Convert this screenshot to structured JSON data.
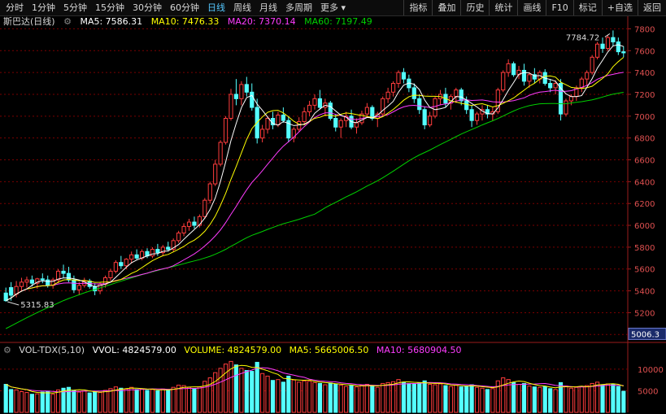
{
  "toolbar": {
    "periods": [
      "分时",
      "1分钟",
      "5分钟",
      "15分钟",
      "30分钟",
      "60分钟",
      "日线",
      "周线",
      "月线",
      "多周期",
      "更多"
    ],
    "active_period": "日线",
    "right_buttons": [
      "指标",
      "叠加",
      "历史",
      "统计",
      "画线",
      "F10",
      "标记",
      "+自选",
      "返回"
    ]
  },
  "price_panel": {
    "stock_name": "斯巴达(日线)",
    "ma5": "MA5: 7586.31",
    "ma10": "MA10: 7476.33",
    "ma20": "MA20: 7370.14",
    "ma60": "MA60: 7197.49",
    "high_marker": "7784.72",
    "low_marker": "5315.83",
    "current_price_tag": "5006.3",
    "y_ticks": [
      "7800",
      "7600",
      "7400",
      "7200",
      "7000",
      "6800",
      "6600",
      "6400",
      "6200",
      "6000",
      "5800",
      "5600",
      "5400",
      "5200",
      "5000"
    ]
  },
  "volume_panel": {
    "indicator": "VOL-TDX(5,10)",
    "vvol": "VVOL: 4824579.00",
    "volume": "VOLUME: 4824579.00",
    "ma5": "MA5: 5665006.50",
    "ma10": "MA10: 5680904.50",
    "y_ticks": [
      "10000",
      "5000"
    ]
  },
  "colors": {
    "up": "#ff3c3c",
    "down": "#54ffff",
    "ma5": "#ffffff",
    "ma10": "#ffff00",
    "ma20": "#ff3cff",
    "ma60": "#00d000",
    "grid": "#7a0000"
  },
  "chart_data": {
    "type": "candlestick",
    "price_range": [
      4950,
      7900
    ],
    "volume_range": [
      0,
      13000
    ],
    "candles": [
      [
        5380,
        5430,
        5300,
        5310,
        6500
      ],
      [
        5430,
        5480,
        5310,
        5360,
        5300
      ],
      [
        5370,
        5490,
        5340,
        5440,
        5200
      ],
      [
        5440,
        5520,
        5400,
        5480,
        4800
      ],
      [
        5480,
        5530,
        5430,
        5500,
        4600
      ],
      [
        5500,
        5540,
        5440,
        5470,
        4200
      ],
      [
        5470,
        5520,
        5420,
        5510,
        4300
      ],
      [
        5510,
        5560,
        5470,
        5500,
        4700
      ],
      [
        5500,
        5540,
        5430,
        5450,
        4900
      ],
      [
        5450,
        5520,
        5420,
        5500,
        4200
      ],
      [
        5500,
        5600,
        5470,
        5580,
        5200
      ],
      [
        5580,
        5640,
        5520,
        5560,
        5600
      ],
      [
        5560,
        5620,
        5480,
        5500,
        5800
      ],
      [
        5500,
        5540,
        5380,
        5410,
        5000
      ],
      [
        5410,
        5480,
        5360,
        5450,
        4700
      ],
      [
        5450,
        5520,
        5430,
        5490,
        4900
      ],
      [
        5490,
        5510,
        5420,
        5440,
        4500
      ],
      [
        5440,
        5470,
        5360,
        5400,
        4800
      ],
      [
        5400,
        5480,
        5370,
        5460,
        4600
      ],
      [
        5460,
        5540,
        5430,
        5520,
        5100
      ],
      [
        5520,
        5600,
        5490,
        5580,
        5500
      ],
      [
        5580,
        5680,
        5560,
        5660,
        5900
      ],
      [
        5660,
        5720,
        5600,
        5630,
        5600
      ],
      [
        5630,
        5700,
        5600,
        5690,
        5400
      ],
      [
        5690,
        5760,
        5650,
        5730,
        5800
      ],
      [
        5730,
        5780,
        5680,
        5700,
        5300
      ],
      [
        5700,
        5780,
        5680,
        5760,
        5400
      ],
      [
        5760,
        5790,
        5700,
        5720,
        5100
      ],
      [
        5720,
        5800,
        5700,
        5780,
        5300
      ],
      [
        5780,
        5830,
        5720,
        5750,
        5000
      ],
      [
        5750,
        5820,
        5720,
        5800,
        5400
      ],
      [
        5800,
        5850,
        5760,
        5780,
        5200
      ],
      [
        5780,
        5880,
        5760,
        5860,
        5800
      ],
      [
        5860,
        5950,
        5840,
        5930,
        6300
      ],
      [
        5930,
        6020,
        5900,
        5990,
        6200
      ],
      [
        5990,
        6060,
        5950,
        6030,
        5800
      ],
      [
        6030,
        6080,
        5970,
        6000,
        5500
      ],
      [
        6000,
        6100,
        5980,
        6080,
        5900
      ],
      [
        6080,
        6250,
        6060,
        6230,
        7200
      ],
      [
        6230,
        6400,
        6200,
        6380,
        8000
      ],
      [
        6380,
        6600,
        6360,
        6560,
        9200
      ],
      [
        6560,
        6780,
        6540,
        6760,
        10200
      ],
      [
        6760,
        7000,
        6740,
        6980,
        11200
      ],
      [
        6980,
        7250,
        6960,
        7200,
        11800
      ],
      [
        7200,
        7340,
        7100,
        7160,
        11000
      ],
      [
        7160,
        7320,
        7100,
        7290,
        10200
      ],
      [
        7290,
        7360,
        7180,
        7220,
        9700
      ],
      [
        7220,
        7300,
        7050,
        7080,
        9500
      ],
      [
        7080,
        7160,
        6750,
        6800,
        11600
      ],
      [
        6800,
        6920,
        6760,
        6880,
        9000
      ],
      [
        6880,
        7000,
        6840,
        6980,
        8400
      ],
      [
        6980,
        7040,
        6880,
        6920,
        7400
      ],
      [
        6920,
        7040,
        6900,
        7010,
        7600
      ],
      [
        7010,
        7080,
        6940,
        6960,
        7000
      ],
      [
        6960,
        7000,
        6760,
        6800,
        8400
      ],
      [
        6800,
        6900,
        6760,
        6880,
        7500
      ],
      [
        6880,
        6990,
        6860,
        6950,
        7000
      ],
      [
        6950,
        7080,
        6920,
        7040,
        7300
      ],
      [
        7040,
        7140,
        7000,
        7100,
        7200
      ],
      [
        7100,
        7200,
        7060,
        7160,
        6900
      ],
      [
        7160,
        7240,
        7060,
        7080,
        6700
      ],
      [
        7080,
        7160,
        7000,
        7120,
        6400
      ],
      [
        7120,
        7140,
        6960,
        6980,
        6800
      ],
      [
        6980,
        7020,
        6860,
        6900,
        6500
      ],
      [
        6900,
        6980,
        6800,
        6960,
        6300
      ],
      [
        6960,
        7040,
        6900,
        7000,
        6000
      ],
      [
        7000,
        7060,
        6880,
        6900,
        6200
      ],
      [
        6900,
        6980,
        6840,
        6940,
        5900
      ],
      [
        6940,
        7050,
        6920,
        7020,
        6300
      ],
      [
        7020,
        7120,
        6990,
        7080,
        6500
      ],
      [
        7080,
        7100,
        6960,
        6980,
        6100
      ],
      [
        6980,
        7040,
        6900,
        7020,
        5800
      ],
      [
        7020,
        7180,
        7000,
        7160,
        6700
      ],
      [
        7160,
        7260,
        7120,
        7220,
        6900
      ],
      [
        7220,
        7320,
        7180,
        7300,
        7100
      ],
      [
        7300,
        7420,
        7260,
        7400,
        7600
      ],
      [
        7400,
        7440,
        7300,
        7340,
        7000
      ],
      [
        7340,
        7380,
        7220,
        7260,
        6700
      ],
      [
        7260,
        7300,
        7120,
        7160,
        6500
      ],
      [
        7160,
        7200,
        7020,
        7060,
        6800
      ],
      [
        7060,
        7090,
        6880,
        6920,
        7300
      ],
      [
        6920,
        7040,
        6900,
        7000,
        6500
      ],
      [
        7000,
        7180,
        6980,
        7160,
        6400
      ],
      [
        7160,
        7240,
        7100,
        7200,
        6600
      ],
      [
        7200,
        7260,
        7080,
        7120,
        6200
      ],
      [
        7120,
        7200,
        7060,
        7180,
        6000
      ],
      [
        7180,
        7260,
        7120,
        7240,
        6300
      ],
      [
        7240,
        7260,
        7100,
        7140,
        5900
      ],
      [
        7140,
        7180,
        7020,
        7060,
        6100
      ],
      [
        7060,
        7100,
        6900,
        6960,
        6400
      ],
      [
        6960,
        7040,
        6920,
        7020,
        5800
      ],
      [
        7020,
        7100,
        6960,
        7060,
        5600
      ],
      [
        7060,
        7100,
        6980,
        7020,
        5300
      ],
      [
        7020,
        7080,
        6960,
        7040,
        5500
      ],
      [
        7040,
        7260,
        7020,
        7240,
        7300
      ],
      [
        7240,
        7420,
        7220,
        7400,
        8000
      ],
      [
        7400,
        7520,
        7360,
        7480,
        7600
      ],
      [
        7480,
        7500,
        7360,
        7380,
        6900
      ],
      [
        7380,
        7460,
        7340,
        7420,
        6500
      ],
      [
        7420,
        7480,
        7280,
        7320,
        6700
      ],
      [
        7320,
        7400,
        7260,
        7380,
        6100
      ],
      [
        7380,
        7440,
        7300,
        7340,
        5900
      ],
      [
        7340,
        7420,
        7300,
        7400,
        5800
      ],
      [
        7400,
        7430,
        7280,
        7300,
        6000
      ],
      [
        7300,
        7340,
        7220,
        7260,
        5500
      ],
      [
        7260,
        7330,
        7200,
        7300,
        5300
      ],
      [
        7300,
        7340,
        6960,
        7020,
        6900
      ],
      [
        7020,
        7160,
        7000,
        7140,
        6100
      ],
      [
        7140,
        7200,
        7100,
        7180,
        5600
      ],
      [
        7180,
        7280,
        7140,
        7260,
        5800
      ],
      [
        7260,
        7360,
        7220,
        7340,
        6000
      ],
      [
        7340,
        7420,
        7280,
        7400,
        6200
      ],
      [
        7400,
        7560,
        7380,
        7540,
        6700
      ],
      [
        7540,
        7680,
        7520,
        7660,
        7000
      ],
      [
        7660,
        7720,
        7580,
        7620,
        6400
      ],
      [
        7620,
        7740,
        7600,
        7720,
        6600
      ],
      [
        7720,
        7785,
        7640,
        7680,
        6500
      ],
      [
        7680,
        7720,
        7560,
        7590,
        6000
      ],
      [
        7590,
        7640,
        7540,
        7580,
        4900
      ]
    ]
  }
}
